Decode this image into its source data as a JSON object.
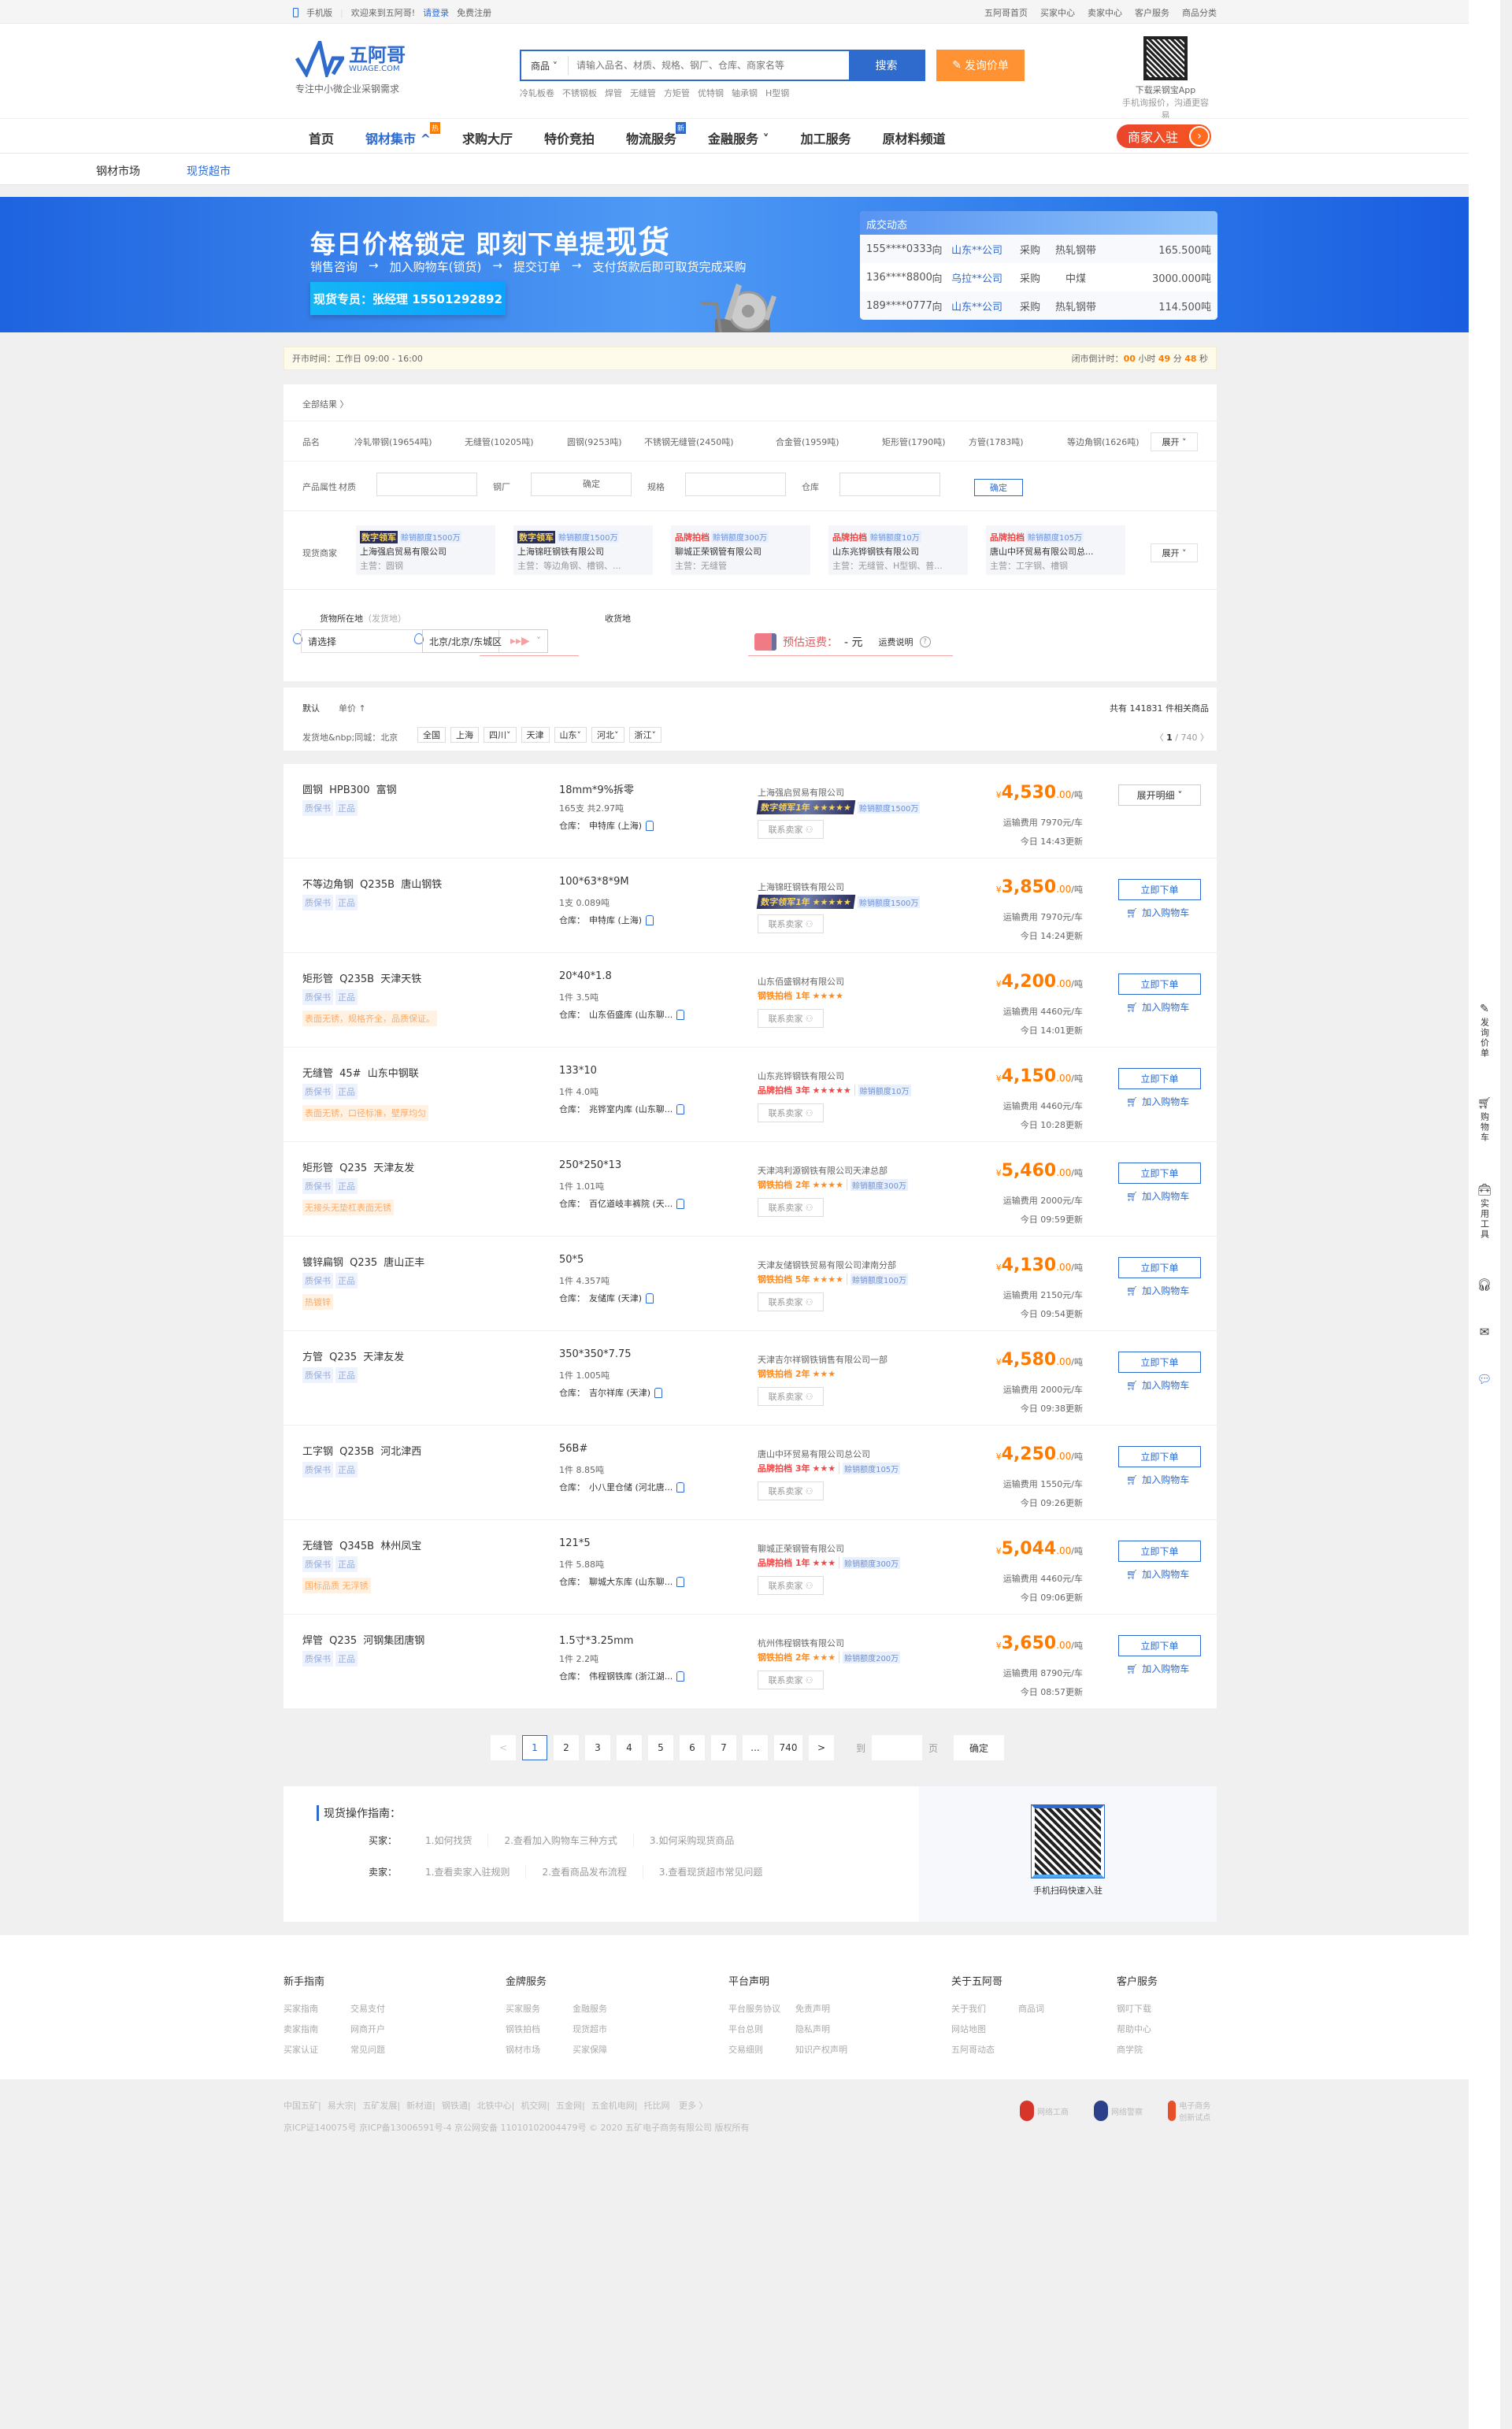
{
  "topbar": {
    "mobile": "手机版",
    "welcome": "欢迎来到五阿哥!",
    "login": "请登录",
    "register": "免费注册",
    "right": [
      "五阿哥首页",
      "买家中心",
      "卖家中心",
      "客户服务",
      "商品分类"
    ]
  },
  "header": {
    "logo_name": "五阿哥",
    "logo_domain": "WUAGE.COM",
    "slogan": "专注中小微企业采钢需求",
    "search_category": "商品",
    "search_placeholder": "请输入品名、材质、规格、钢厂、仓库、商家名等",
    "search_button": "搜索",
    "ask_button": "发询价单",
    "hot": [
      "冷轧板卷",
      "不锈钢板",
      "焊管",
      "无缝管",
      "方矩管",
      "优特钢",
      "轴承钢",
      "H型钢"
    ],
    "qr_title": "下载采钢宝App",
    "qr_sub": "手机询报价，沟通更容易"
  },
  "nav": {
    "items": [
      {
        "label": "首页"
      },
      {
        "label": "钢材集市 ^",
        "badge": "热",
        "active": true
      },
      {
        "label": "求购大厅"
      },
      {
        "label": "特价竞拍"
      },
      {
        "label": "物流服务",
        "badge": "新"
      },
      {
        "label": "金融服务 ˅"
      },
      {
        "label": "加工服务"
      },
      {
        "label": "原材料频道"
      }
    ],
    "join": "商家入驻"
  },
  "subnav": {
    "items": [
      "钢材市场",
      "现货超市"
    ],
    "active": 1
  },
  "banner": {
    "title_a": "每日价格锁定 即刻下单提",
    "title_b": "现货",
    "steps": [
      "销售咨询",
      "加入购物车(锁货)",
      "提交订单",
      "支付货款后即可取货完成采购"
    ],
    "rep": "现货专员：张经理 15501292892",
    "deals_title": "成交动态",
    "deals": [
      {
        "phone": "155****0333",
        "to": "向",
        "co": "山东**公司",
        "act": "采购",
        "item": "热轧钢带",
        "qty": "165.500吨"
      },
      {
        "phone": "136****8800",
        "to": "向",
        "co": "乌拉**公司",
        "act": "采购",
        "item": "中煤",
        "qty": "3000.000吨"
      },
      {
        "phone": "189****0777",
        "to": "向",
        "co": "山东**公司",
        "act": "采购",
        "item": "热轧钢带",
        "qty": "114.500吨"
      }
    ]
  },
  "notice": {
    "hours": "开市时间：工作日 09:00 - 16:00",
    "countdown_label": "闭市倒计时：",
    "h": "00",
    "h_unit": "小时",
    "m": "49",
    "m_unit": "分",
    "s": "48",
    "s_unit": "秒"
  },
  "filters": {
    "all": "全部结果 〉",
    "name_label": "品名",
    "names": [
      "冷轧带钢(19654吨)",
      "无缝管(10205吨)",
      "圆钢(9253吨)",
      "不锈钢无缝管(2450吨)",
      "合金管(1959吨)",
      "矩形管(1790吨)",
      "方管(1783吨)",
      "等边角钢(1626吨)"
    ],
    "expand": "展开 ˅",
    "attr_label": "产品属性",
    "attrs": [
      "材质",
      "钢厂",
      "规格",
      "仓库"
    ],
    "confirm": "确定",
    "merchant_label": "现货商家",
    "merchants": [
      {
        "tag": "数字领军",
        "type": "dig",
        "quota": "赊销额度1500万",
        "name": "上海强启贸易有限公司",
        "main": "主营：圆钢"
      },
      {
        "tag": "数字领军",
        "type": "dig",
        "quota": "赊销额度1500万",
        "name": "上海锦旺钢铁有限公司",
        "main": "主营：等边角钢、槽钢、..."
      },
      {
        "tag": "品牌拍档",
        "type": "brand",
        "quota": "赊销额度300万",
        "name": "聊城正荣钢管有限公司",
        "main": "主营：无缝管"
      },
      {
        "tag": "品牌拍档",
        "type": "brand",
        "quota": "赊销额度10万",
        "name": "山东兆铧钢铁有限公司",
        "main": "主营：无缝管、H型钢、普..."
      },
      {
        "tag": "品牌拍档",
        "type": "brand",
        "quota": "赊销额度105万",
        "name": "唐山中环贸易有限公司总...",
        "main": "主营：工字钢、槽钢"
      }
    ],
    "origin_label": "货物所在地",
    "origin_hint": "（发货地）",
    "origin_value": "请选择",
    "dest_label": "收货地",
    "dest_value": "北京/北京/东城区",
    "freight_label": "预估运费：",
    "freight_value": "- 元",
    "freight_help": "运费说明"
  },
  "sort": {
    "default": "默认",
    "price": "单价 ↑",
    "total": "共有 141831 件相关商品",
    "ship_label": "发货地",
    "same_city": "同城：北京",
    "regions": [
      "全国",
      "上海",
      "四川˅",
      "天津",
      "山东˅",
      "河北˅",
      "浙江˅"
    ],
    "page": "1",
    "pages": "/ 740"
  },
  "labels": {
    "order": "立即下单",
    "cart": "加入购物车",
    "contact": "联系卖家",
    "detail": "展开明细 ˅",
    "wh_prefix": "仓库：",
    "tq1": "质保书",
    "tq2": "正品",
    "unit": "/吨",
    "yen": "¥"
  },
  "products": [
    {
      "name": "圆钢 HPB300 富钢",
      "spec": "18mm*9%拆零",
      "qty": "165支 共2.97吨",
      "wh": "申特库 (上海)",
      "desc": "",
      "seller": "上海强启贸易有限公司",
      "badge": "数字领军1年",
      "type": "dig",
      "stars": 5,
      "quota": "赊销额度1500万",
      "price": "4,530",
      "cents": ".00",
      "freight": "运输费用 7970元/车",
      "updated": "今日 14:43更新",
      "detail": true
    },
    {
      "name": "不等边角钢 Q235B 唐山钢铁",
      "spec": "100*63*8*9M",
      "qty": "1支 0.089吨",
      "wh": "申特库 (上海)",
      "desc": "",
      "seller": "上海锦旺钢铁有限公司",
      "badge": "数字领军1年",
      "type": "dig",
      "stars": 5,
      "quota": "赊销额度1500万",
      "price": "3,850",
      "cents": ".00",
      "freight": "运输费用 7970元/车",
      "updated": "今日 14:24更新"
    },
    {
      "name": "矩形管 Q235B 天津天铁",
      "spec": "20*40*1.8",
      "qty": "1件 3.5吨",
      "wh": "山东佰盛库 (山东聊...",
      "desc": "表面无锈，规格齐全，品质保证。",
      "seller": "山东佰盛钢材有限公司",
      "badge": "钢铁拍档 1年",
      "type": "steel",
      "stars": 4,
      "quota": "",
      "price": "4,200",
      "cents": ".00",
      "freight": "运输费用 4460元/车",
      "updated": "今日 14:01更新"
    },
    {
      "name": "无缝管 45# 山东中钢联",
      "spec": "133*10",
      "qty": "1件 4.0吨",
      "wh": "兆铧室内库 (山东聊...",
      "desc": "表面无锈，口径标准，壁厚均匀",
      "seller": "山东兆铧钢铁有限公司",
      "badge": "品牌拍档 3年",
      "type": "brand",
      "stars": 5,
      "quota": "赊销额度10万",
      "price": "4,150",
      "cents": ".00",
      "freight": "运输费用 4460元/车",
      "updated": "今日 10:28更新"
    },
    {
      "name": "矩形管 Q235 天津友发",
      "spec": "250*250*13",
      "qty": "1件 1.01吨",
      "wh": "百亿道岐丰裤院 (天...",
      "desc": "无接头无垫杠表面无锈",
      "seller": "天津鸿利源钢铁有限公司天津总部",
      "badge": "钢铁拍档 2年",
      "type": "steel",
      "stars": 4,
      "quota": "赊销额度300万",
      "price": "5,460",
      "cents": ".00",
      "freight": "运输费用 2000元/车",
      "updated": "今日 09:59更新"
    },
    {
      "name": "镀锌扁钢 Q235 唐山正丰",
      "spec": "50*5",
      "qty": "1件 4.357吨",
      "wh": "友储库 (天津)",
      "desc": "热镀锌",
      "seller": "天津友储钢铁贸易有限公司津南分部",
      "badge": "钢铁拍档 5年",
      "type": "steel",
      "stars": 4,
      "quota": "赊销额度100万",
      "price": "4,130",
      "cents": ".00",
      "freight": "运输费用 2150元/车",
      "updated": "今日 09:54更新"
    },
    {
      "name": "方管 Q235 天津友发",
      "spec": "350*350*7.75",
      "qty": "1件 1.005吨",
      "wh": "吉尔祥库 (天津)",
      "desc": "",
      "seller": "天津吉尔祥钢铁销售有限公司一部",
      "badge": "钢铁拍档 2年",
      "type": "steel",
      "stars": 3,
      "quota": "",
      "price": "4,580",
      "cents": ".00",
      "freight": "运输费用 2000元/车",
      "updated": "今日 09:38更新"
    },
    {
      "name": "工字钢 Q235B 河北津西",
      "spec": "56B#",
      "qty": "1件 8.85吨",
      "wh": "小八里仓储 (河北唐...",
      "desc": "",
      "seller": "唐山中环贸易有限公司总公司",
      "badge": "品牌拍档 3年",
      "type": "brand",
      "stars": 3,
      "quota": "赊销额度105万",
      "price": "4,250",
      "cents": ".00",
      "freight": "运输费用 1550元/车",
      "updated": "今日 09:26更新"
    },
    {
      "name": "无缝管 Q345B 林州凤宝",
      "spec": "121*5",
      "qty": "1件 5.88吨",
      "wh": "聊城大东库 (山东聊...",
      "desc": "国标品质 无浮锈",
      "seller": "聊城正荣钢管有限公司",
      "badge": "品牌拍档 1年",
      "type": "brand",
      "stars": 3,
      "quota": "赊销额度300万",
      "price": "5,044",
      "cents": ".00",
      "freight": "运输费用 4460元/车",
      "updated": "今日 09:06更新"
    },
    {
      "name": "焊管 Q235 河钢集团唐钢",
      "spec": "1.5寸*3.25mm",
      "qty": "1件 2.2吨",
      "wh": "伟程钢铁库 (浙江湖...",
      "desc": "",
      "seller": "杭州伟程钢铁有限公司",
      "badge": "钢铁拍档 2年",
      "type": "steel",
      "stars": 3,
      "quota": "赊销额度200万",
      "price": "3,650",
      "cents": ".00",
      "freight": "运输费用 8790元/车",
      "updated": "今日 08:57更新"
    }
  ],
  "pager": {
    "prev": "<",
    "pages": [
      "1",
      "2",
      "3",
      "4",
      "5",
      "6",
      "7",
      "...",
      "740"
    ],
    "next": ">",
    "goto": "到",
    "page_unit": "页",
    "confirm": "确定",
    "current": "1"
  },
  "guide": {
    "title": "现货操作指南：",
    "buyer": "买家：",
    "buyer_links": [
      "1.如何找货",
      "2.查看加入购物车三种方式",
      "3.如何采购现货商品"
    ],
    "seller": "卖家：",
    "seller_links": [
      "1.查看卖家入驻规则",
      "2.查看商品发布流程",
      "3.查看现货超市常见问题"
    ],
    "qr_text": "手机扫码快速入驻"
  },
  "footer": {
    "cols": [
      {
        "title": "新手指南",
        "links": [
          "买家指南",
          "交易支付",
          "卖家指南",
          "网商开户",
          "买家认证",
          "常见问题"
        ]
      },
      {
        "title": "金牌服务",
        "links": [
          "买家服务",
          "金融服务",
          "钢铁拍档",
          "现货超市",
          "钢材市场",
          "买家保障"
        ]
      },
      {
        "title": "平台声明",
        "links": [
          "平台服务协议",
          "免责声明",
          "平台总则",
          "隐私声明",
          "交易细则",
          "知识产权声明"
        ]
      },
      {
        "title": "关于五阿哥",
        "links": [
          "关于我们",
          "商品词",
          "网站地图",
          "",
          "五阿哥动态",
          ""
        ]
      },
      {
        "title": "客户服务",
        "links": [
          "钢叮下载",
          "帮助中心",
          "商学院"
        ]
      }
    ],
    "friends": [
      "中国五矿",
      "易大宗",
      "五矿发展",
      "新材道",
      "钢铁通",
      "北铁中心",
      "机交网",
      "五金网",
      "五金机电网",
      "托比网",
      "更多 〉"
    ],
    "icp": "京ICP证140075号  京ICP备13006591号-4  京公网安备 11010102004479号  © 2020  五矿电子商务有限公司 版权所有",
    "badges": [
      "网络工商",
      "网络警察",
      "电子商务创新试点"
    ]
  },
  "sidebar": [
    "发询价单",
    "购物车",
    "实用工具"
  ]
}
